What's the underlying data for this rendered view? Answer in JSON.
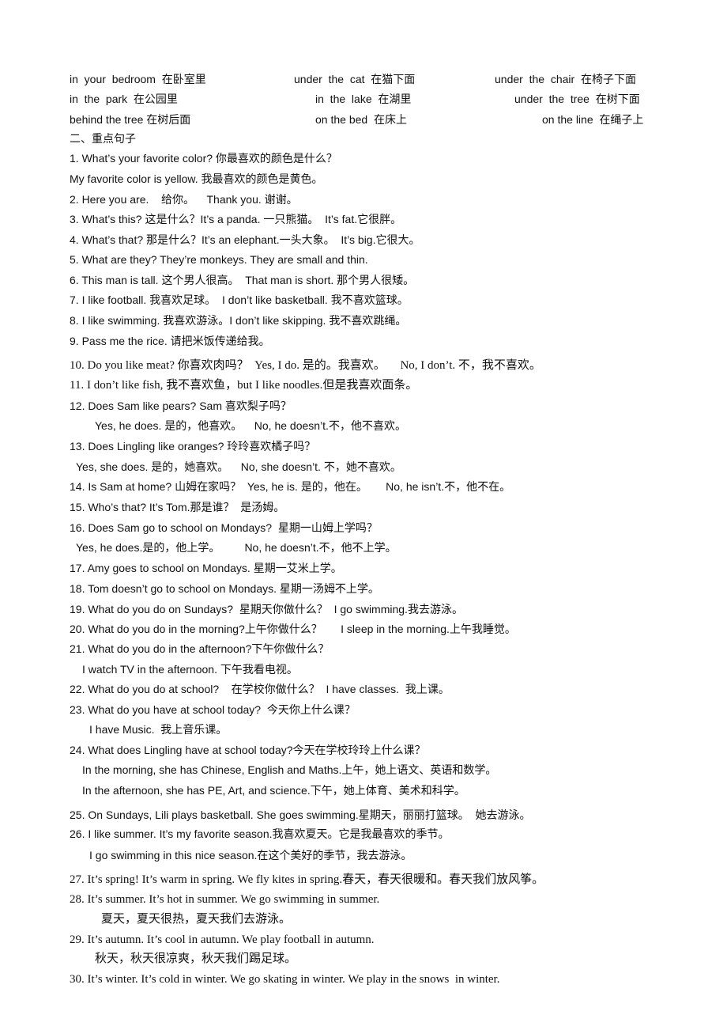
{
  "phrases": [
    [
      "in  your  bedroom  在卧室里",
      "under  the  cat  在猫下面",
      "under  the  chair  在椅子下面"
    ],
    [
      "in  the  park  在公园里",
      "in  the  lake  在湖里",
      "under  the  tree  在树下面"
    ],
    [
      "behind the tree 在树后面",
      "on the bed  在床上",
      "on the line  在绳子上"
    ]
  ],
  "section_heading": "二、重点句子",
  "sentences": [
    "1. What’s your favorite color? 你最喜欢的颜色是什么？",
    "My favorite color is yellow. 我最喜欢的颜色是黄色。",
    "2. Here you are.    给你。    Thank you. 谢谢。",
    "3. What’s this? 这是什么？It’s a panda. 一只熊猫。  It’s fat.它很胖。",
    "4. What’s that? 那是什么？It’s an elephant.一头大象。  It’s big.它很大。",
    "5. What are they? They’re monkeys. They are small and thin.",
    "6. This man is tall. 这个男人很高。  That man is short. 那个男人很矮。",
    "7. I like football. 我喜欢足球。  I don’t like basketball. 我不喜欢篮球。",
    "8. I like swimming. 我喜欢游泳。I don’t like skipping. 我不喜欢跳绳。",
    "9. Pass me the rice. 请把米饭传递给我。",
    "10. Do you like meat? 你喜欢肉吗？  Yes, I do. 是的。我喜欢。     No, I don’t. 不，我不喜欢。",
    "11. I don’t like fish, 我不喜欢鱼，but I like noodles.但是我喜欢面条。",
    "12. Does Sam like pears? Sam 喜欢梨子吗？",
    "Yes, he does. 是的，他喜欢。    No, he doesn’t.不，他不喜欢。",
    "13. Does Lingling like oranges? 玲玲喜欢橘子吗？",
    "Yes, she does. 是的，她喜欢。    No, she doesn’t. 不，她不喜欢。",
    "14. Is Sam at home? 山姆在家吗？  Yes, he is. 是的，他在。      No, he isn’t.不，他不在。",
    "15. Who’s that? It’s Tom.那是谁？  是汤姆。",
    "16. Does Sam go to school on Mondays?  星期一山姆上学吗？",
    "Yes, he does.是的，他上学。        No, he doesn’t.不，他不上学。",
    "17. Amy goes to school on Mondays. 星期一艾米上学。",
    "18. Tom doesn’t go to school on Mondays. 星期一汤姆不上学。",
    "19. What do you do on Sundays?  星期天你做什么？  I go swimming.我去游泳。",
    "20. What do you do in the morning?上午你做什么？      I sleep in the morning.上午我睡觉。",
    "21. What do you do in the afternoon?下午你做什么？",
    "I watch TV in the afternoon. 下午我看电视。",
    "22. What do you do at school?    在学校你做什么？  I have classes.  我上课。",
    "23. What do you have at school today?  今天你上什么课？",
    "I have Music.  我上音乐课。",
    "24. What does Lingling have at school today?今天在学校玲玲上什么课？",
    "In the morning, she has Chinese, English and Maths.上午，她上语文、英语和数学。",
    "In the afternoon, she has PE, Art, and science.下午，她上体育、美术和科学。",
    "25. On Sundays, Lili plays basketball. She goes swimming.星期天，丽丽打篮球。  她去游泳。",
    "26. I like summer. It’s my favorite season.我喜欢夏天。它是我最喜欢的季节。",
    "I go swimming in this nice season.在这个美好的季节，我去游泳。",
    "27. It’s spring! It’s warm in spring. We fly kites in spring.春天，春天很暖和。春天我们放风筝。",
    "28. It’s summer. It’s hot in summer. We go swimming in summer.",
    "夏天，夏天很热，夏天我们去游泳。",
    "29. It’s autumn. It’s cool in autumn. We play football in autumn.",
    "秋天，秋天很凉爽，秋天我们踢足球。",
    "30. It’s winter. It’s cold in winter. We go skating in winter. We play in the snows  in winter."
  ]
}
